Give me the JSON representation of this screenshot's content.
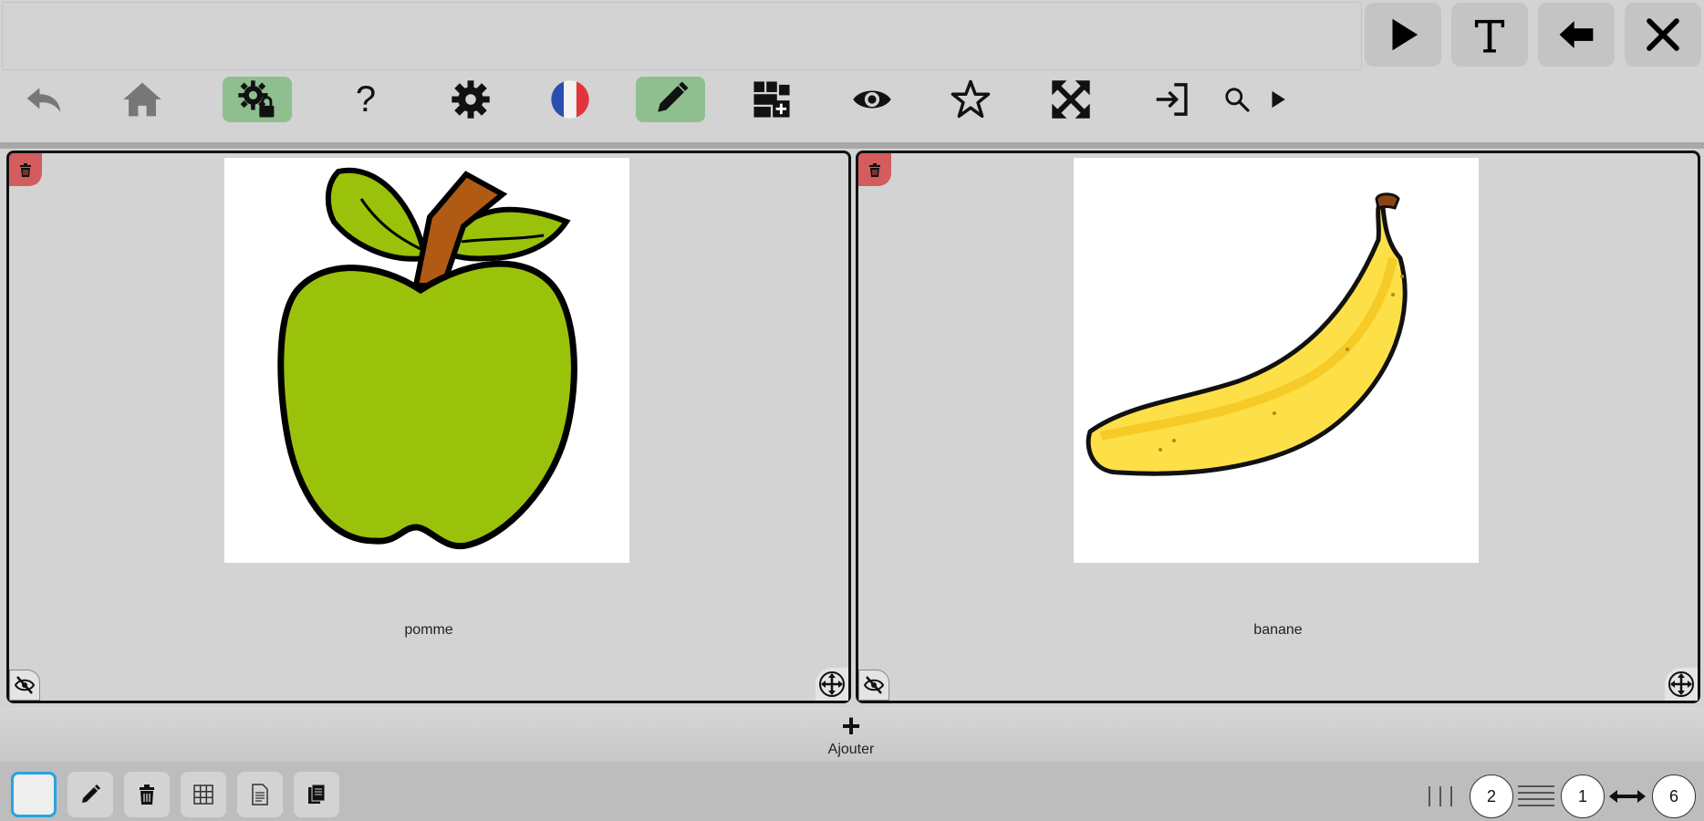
{
  "topbar": {
    "sentence_text": "",
    "buttons": [
      {
        "name": "play-button",
        "icon": "play-icon"
      },
      {
        "name": "text-mode-button",
        "icon": "text-icon"
      },
      {
        "name": "backspace-button",
        "icon": "backspace-arrow-icon"
      },
      {
        "name": "clear-button",
        "icon": "close-icon"
      }
    ]
  },
  "toolbar": {
    "help_label": "?",
    "items": [
      "undo-icon",
      "home-icon",
      "lock-settings-icon",
      "help-icon",
      "gear-icon",
      "french-flag-icon",
      "pencil-icon",
      "add-grid-icon",
      "eye-icon",
      "star-icon",
      "fullscreen-icon",
      "login-icon",
      "search-icon",
      "play-small-icon"
    ]
  },
  "cards": [
    {
      "label": "pomme",
      "image": "green-apple"
    },
    {
      "label": "banane",
      "image": "banana"
    }
  ],
  "add": {
    "label": "Ajouter",
    "symbol": "+"
  },
  "layout_controls": {
    "columns": "2",
    "rows": "1",
    "width": "6"
  },
  "colors": {
    "active_green": "#8fbf8f",
    "delete_red": "#d45c5c",
    "selection_blue": "#29a3e0",
    "apple_green": "#9bc20a",
    "banana_yellow": "#fde047"
  }
}
